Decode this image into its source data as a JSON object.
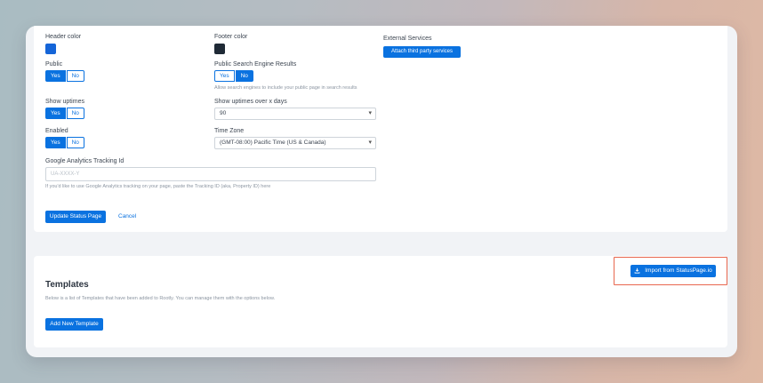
{
  "status_page_form": {
    "header_color": {
      "label": "Header color",
      "value": "#1565d8"
    },
    "footer_color": {
      "label": "Footer color",
      "value": "#1f2a36"
    },
    "external_services": {
      "label": "External Services",
      "button": "Attach third party services"
    },
    "public": {
      "label": "Public",
      "options": [
        "Yes",
        "No"
      ],
      "selected": "Yes"
    },
    "search_engine": {
      "label": "Public Search Engine Results",
      "options": [
        "Yes",
        "No"
      ],
      "selected": "No",
      "help": "Allow search engines to include your public page in search results"
    },
    "show_uptimes": {
      "label": "Show uptimes",
      "options": [
        "Yes",
        "No"
      ],
      "selected": "Yes"
    },
    "uptime_days": {
      "label": "Show uptimes over x days",
      "value": "90"
    },
    "enabled": {
      "label": "Enabled",
      "options": [
        "Yes",
        "No"
      ],
      "selected": "Yes"
    },
    "time_zone": {
      "label": "Time Zone",
      "value": "(GMT-08:00) Pacific Time (US & Canada)"
    },
    "google_analytics": {
      "label": "Google Analytics Tracking Id",
      "placeholder": "UA-XXXX-Y",
      "help": "If you'd like to use Google Analytics tracking on your page, paste the Tracking ID (aka, Property ID) here"
    },
    "update_button": "Update Status Page",
    "cancel_link": "Cancel"
  },
  "templates": {
    "title": "Templates",
    "description": "Below is a list of Templates that have been added to Rootly. You can manage them with the options below.",
    "import_button": "Import from StatusPage.io",
    "add_button": "Add New Template"
  },
  "colors": {
    "accent": "#0a72e0",
    "highlight": "#e8674f"
  },
  "icons": {
    "import": "download-icon",
    "select": "chevron-down-icon"
  }
}
